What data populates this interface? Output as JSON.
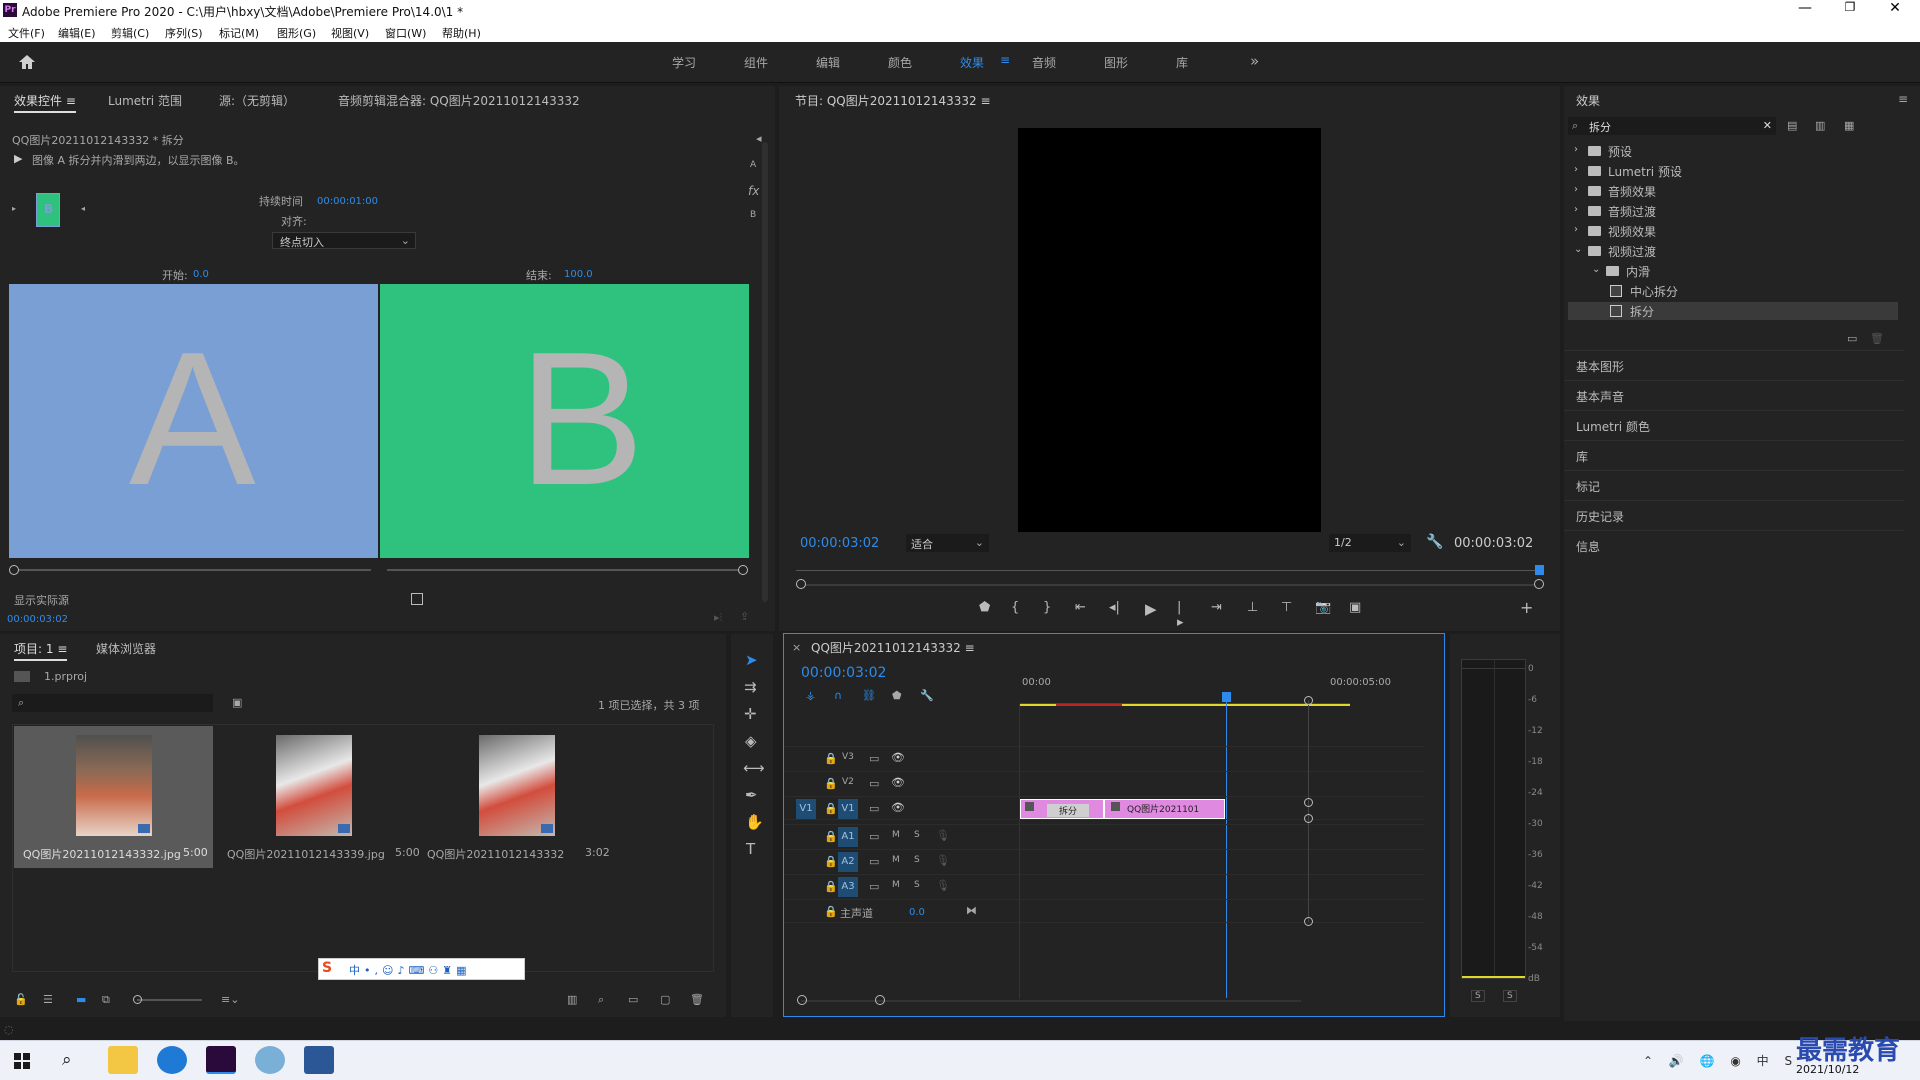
{
  "title": {
    "text": "Adobe Premiere Pro 2020 - C:\\用户\\hbxy\\文档\\Adobe\\Premiere Pro\\14.0\\1 *"
  },
  "menu": [
    "文件(F)",
    "编辑(E)",
    "剪辑(C)",
    "序列(S)",
    "标记(M)",
    "图形(G)",
    "视图(V)",
    "窗口(W)",
    "帮助(H)"
  ],
  "workspaces": [
    "学习",
    "组件",
    "编辑",
    "颜色",
    "效果",
    "音频",
    "图形",
    "库"
  ],
  "active_workspace": "效果",
  "source_tabs": [
    "效果控件",
    "Lumetri 范围",
    "源:（无剪辑）",
    "音频剪辑混合器: QQ图片20211012143332"
  ],
  "effect_controls": {
    "clip": "QQ图片20211012143332 * 拆分",
    "description": "图像 A 拆分并内滑到两边，以显示图像 B。",
    "duration_label": "持续时间",
    "duration": "00:00:01:00",
    "align_label": "对齐:",
    "align_value": "终点切入",
    "start_label": "开始:",
    "start": "0.0",
    "end_label": "结束:",
    "end": "100.0",
    "letter_a": "A",
    "letter_b": "B",
    "show_actual_sources": "显示实际源",
    "timecode": "00:00:03:02",
    "side_a": "A",
    "side_b": "B",
    "fx": "fx",
    "thumb_letter": "B"
  },
  "program": {
    "title": "节目: QQ图片20211012143332",
    "timecode_left": "00:00:03:02",
    "fit": "适合",
    "quality": "1/2",
    "timecode_right": "00:00:03:02"
  },
  "effects_panel": {
    "title": "效果",
    "search": "拆分",
    "tree": [
      {
        "label": "预设",
        "level": 0,
        "expanded": false
      },
      {
        "label": "Lumetri 预设",
        "level": 0,
        "expanded": false
      },
      {
        "label": "音频效果",
        "level": 0,
        "expanded": false
      },
      {
        "label": "音频过渡",
        "level": 0,
        "expanded": false
      },
      {
        "label": "视频效果",
        "level": 0,
        "expanded": false
      },
      {
        "label": "视频过渡",
        "level": 0,
        "expanded": true
      },
      {
        "label": "内滑",
        "level": 1,
        "expanded": true
      },
      {
        "label": "中心拆分",
        "level": 2,
        "selected": false
      },
      {
        "label": "拆分",
        "level": 2,
        "selected": true
      }
    ],
    "sections": [
      "基本图形",
      "基本声音",
      "Lumetri 颜色",
      "库",
      "标记",
      "历史记录",
      "信息"
    ]
  },
  "project": {
    "tabs": [
      "项目: 1",
      "媒体浏览器"
    ],
    "file": "1.prproj",
    "selection": "1 项已选择，共 3 项",
    "items": [
      {
        "name": "QQ图片20211012143332.jpg",
        "dur": "5:00"
      },
      {
        "name": "QQ图片20211012143339.jpg",
        "dur": "5:00"
      },
      {
        "name": "QQ图片20211012143332",
        "dur": "3:02"
      }
    ]
  },
  "timeline": {
    "tab": "QQ图片20211012143332",
    "timecode": "00:00:03:02",
    "ruler": [
      "00:00",
      "00:00:05:00"
    ],
    "video_tracks": [
      "V3",
      "V2",
      "V1"
    ],
    "audio_tracks": [
      "A1",
      "A2",
      "A3"
    ],
    "mute": "M",
    "solo": "S",
    "source_patch": "V1",
    "master": "主声道",
    "master_val": "0.0",
    "transition_label": "拆分",
    "clip_label": "QQ图片2021101"
  },
  "meter": {
    "ticks": [
      "0",
      "-6",
      "-12",
      "-18",
      "-24",
      "-30",
      "-36",
      "-42",
      "-48",
      "-54",
      "dB"
    ],
    "solo_labels": [
      "S",
      "S"
    ]
  },
  "taskbar": {
    "date": "2021/10/12",
    "watermark": "最需教育"
  },
  "colors": {
    "accent": "#2d8ceb",
    "a_color": "#7a9fd4",
    "b_color": "#2ec27e",
    "clip_pink": "#e089e0"
  }
}
